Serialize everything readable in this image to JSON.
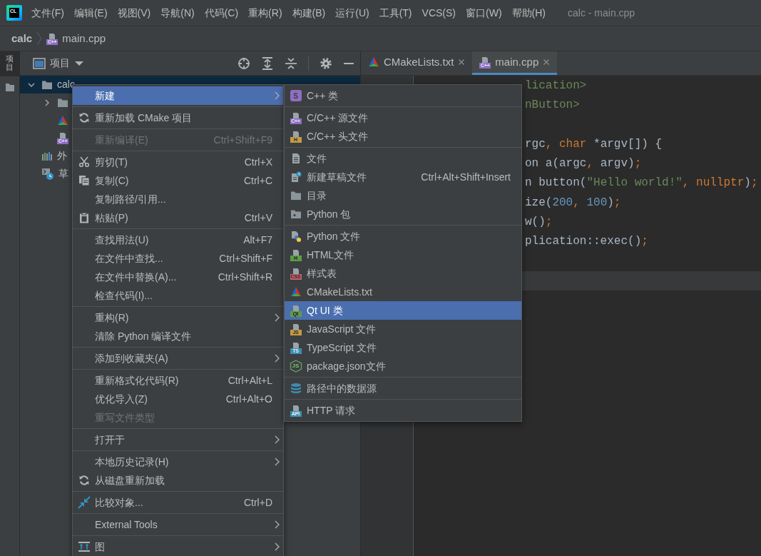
{
  "app_logo": {
    "text": "CL"
  },
  "menu_bar": {
    "items": [
      "文件(F)",
      "编辑(E)",
      "视图(V)",
      "导航(N)",
      "代码(C)",
      "重构(R)",
      "构建(B)",
      "运行(U)",
      "工具(T)",
      "VCS(S)",
      "窗口(W)",
      "帮助(H)"
    ],
    "title": "calc - main.cpp"
  },
  "breadcrumb": [
    {
      "label": "calc",
      "kind": "project"
    },
    {
      "label": "main.cpp",
      "kind": "cpp-source",
      "badge": "C++"
    }
  ],
  "side_strip": {
    "label": "项目",
    "selected": true
  },
  "project_panel": {
    "title": "项目"
  },
  "tree": [
    {
      "label": "calc",
      "kind": "folder",
      "expanded": true,
      "selected": true,
      "children": [
        {
          "kind": "folder",
          "expanded": false,
          "selected": false
        },
        {
          "kind": "cmake",
          "selected": false
        },
        {
          "kind": "cpp-source",
          "badge": "C++",
          "selected": false
        }
      ]
    },
    {
      "label": "外",
      "kind": "libraries",
      "selected": false
    },
    {
      "label": "草",
      "kind": "scratches",
      "selected": false
    }
  ],
  "editor_tabs": [
    {
      "label": "CMakeLists.txt",
      "kind": "cmake",
      "selected": false
    },
    {
      "label": "main.cpp",
      "kind": "cpp-source",
      "badge": "C++",
      "selected": true
    }
  ],
  "code_lines": [
    {
      "current": false,
      "tokens": [
        {
          "text": "lication>",
          "kind": "string"
        }
      ]
    },
    {
      "current": false,
      "tokens": [
        {
          "text": "nButton>",
          "kind": "string"
        }
      ]
    },
    {
      "current": false
    },
    {
      "current": false,
      "tokens": [
        {
          "text": "rgc",
          "kind": "plain"
        },
        {
          "text": ", ",
          "kind": "punct"
        },
        {
          "text": "char",
          "kind": "keyword"
        },
        {
          "text": " *argv[]) {",
          "kind": "plain"
        }
      ]
    },
    {
      "current": false,
      "tokens": [
        {
          "text": "on a(argc",
          "kind": "plain"
        },
        {
          "text": ", ",
          "kind": "punct"
        },
        {
          "text": "argv)",
          "kind": "plain"
        },
        {
          "text": ";",
          "kind": "punct"
        }
      ]
    },
    {
      "current": false,
      "tokens": [
        {
          "text": "n button(",
          "kind": "plain"
        },
        {
          "text": "\"Hello world!\"",
          "kind": "string"
        },
        {
          "text": ", ",
          "kind": "punct"
        },
        {
          "text": "nullptr",
          "kind": "keyword"
        },
        {
          "text": ")",
          "kind": "plain"
        },
        {
          "text": ";",
          "kind": "punct"
        }
      ]
    },
    {
      "current": false,
      "tokens": [
        {
          "text": "ize(",
          "kind": "plain"
        },
        {
          "text": "200",
          "kind": "number"
        },
        {
          "text": ", ",
          "kind": "punct"
        },
        {
          "text": "100",
          "kind": "number"
        },
        {
          "text": ")",
          "kind": "plain"
        },
        {
          "text": ";",
          "kind": "punct"
        }
      ]
    },
    {
      "current": false,
      "tokens": [
        {
          "text": "w()",
          "kind": "plain"
        },
        {
          "text": ";",
          "kind": "punct"
        }
      ]
    },
    {
      "current": false,
      "tokens": [
        {
          "text": "plication::exec()",
          "kind": "plain"
        },
        {
          "text": ";",
          "kind": "punct"
        }
      ]
    },
    {
      "current": false
    },
    {
      "current": true
    }
  ],
  "context_menu": {
    "groups": [
      [
        {
          "label": "新建",
          "kind": "text",
          "submenu": true,
          "selected": true,
          "disabled": false
        }
      ],
      [
        {
          "label": "重新加载 CMake 项目",
          "kind": "reload",
          "submenu": false,
          "selected": false,
          "disabled": false
        }
      ],
      [
        {
          "label": "重新编译(E)",
          "kind": "text",
          "shortcut": "Ctrl+Shift+F9",
          "submenu": false,
          "selected": false,
          "disabled": true
        }
      ],
      [
        {
          "label": "剪切(T)",
          "kind": "cut",
          "shortcut": "Ctrl+X",
          "submenu": false,
          "selected": false,
          "disabled": false
        },
        {
          "label": "复制(C)",
          "kind": "copy",
          "shortcut": "Ctrl+C",
          "submenu": false,
          "selected": false,
          "disabled": false
        },
        {
          "label": "复制路径/引用...",
          "kind": "text",
          "submenu": false,
          "selected": false,
          "disabled": false
        },
        {
          "label": "粘贴(P)",
          "kind": "paste",
          "shortcut": "Ctrl+V",
          "submenu": false,
          "selected": false,
          "disabled": false
        }
      ],
      [
        {
          "label": "查找用法(U)",
          "kind": "text",
          "shortcut": "Alt+F7",
          "submenu": false,
          "selected": false,
          "disabled": false
        },
        {
          "label": "在文件中查找...",
          "kind": "text",
          "shortcut": "Ctrl+Shift+F",
          "submenu": false,
          "selected": false,
          "disabled": false
        },
        {
          "label": "在文件中替换(A)...",
          "kind": "text",
          "shortcut": "Ctrl+Shift+R",
          "submenu": false,
          "selected": false,
          "disabled": false
        },
        {
          "label": "检查代码(I)...",
          "kind": "text",
          "submenu": false,
          "selected": false,
          "disabled": false
        }
      ],
      [
        {
          "label": "重构(R)",
          "kind": "text",
          "submenu": true,
          "selected": false,
          "disabled": false
        },
        {
          "label": "清除 Python 编译文件",
          "kind": "text",
          "submenu": false,
          "selected": false,
          "disabled": false
        }
      ],
      [
        {
          "label": "添加到收藏夹(A)",
          "kind": "text",
          "submenu": true,
          "selected": false,
          "disabled": false
        }
      ],
      [
        {
          "label": "重新格式化代码(R)",
          "kind": "text",
          "shortcut": "Ctrl+Alt+L",
          "submenu": false,
          "selected": false,
          "disabled": false
        },
        {
          "label": "优化导入(Z)",
          "kind": "text",
          "shortcut": "Ctrl+Alt+O",
          "submenu": false,
          "selected": false,
          "disabled": false
        },
        {
          "label": "重写文件类型",
          "kind": "text",
          "submenu": false,
          "selected": false,
          "disabled": true
        }
      ],
      [
        {
          "label": "打开于",
          "kind": "text",
          "submenu": true,
          "selected": false,
          "disabled": false
        }
      ],
      [
        {
          "label": "本地历史记录(H)",
          "kind": "text",
          "submenu": true,
          "selected": false,
          "disabled": false
        },
        {
          "label": "从磁盘重新加载",
          "kind": "reload",
          "submenu": false,
          "selected": false,
          "disabled": false
        }
      ],
      [
        {
          "label": "比较对象...",
          "kind": "compare",
          "shortcut": "Ctrl+D",
          "submenu": false,
          "selected": false,
          "disabled": false
        }
      ],
      [
        {
          "label": "External Tools",
          "kind": "text",
          "submenu": true,
          "selected": false,
          "disabled": false
        }
      ],
      [
        {
          "label": "图",
          "kind": "diagram",
          "submenu": true,
          "selected": false,
          "disabled": false
        }
      ]
    ]
  },
  "new_submenu": {
    "groups": [
      [
        {
          "label": "C++ 类",
          "kind": "cpp-class",
          "badge": "S",
          "selected": false,
          "disabled": false
        }
      ],
      [
        {
          "label": "C/C++ 源文件",
          "kind": "cpp-source",
          "badge": "C++",
          "selected": false,
          "disabled": false
        },
        {
          "label": "C/C++ 头文件",
          "kind": "header",
          "badge": "H",
          "selected": false,
          "disabled": false
        }
      ],
      [
        {
          "label": "文件",
          "kind": "file",
          "selected": false,
          "disabled": false
        },
        {
          "label": "新建草稿文件",
          "kind": "scratch",
          "shortcut": "Ctrl+Alt+Shift+Insert",
          "selected": false,
          "disabled": false
        },
        {
          "label": "目录",
          "kind": "directory",
          "selected": false,
          "disabled": false
        },
        {
          "label": "Python 包",
          "kind": "python-package",
          "selected": false,
          "disabled": false
        }
      ],
      [
        {
          "label": "Python 文件",
          "kind": "python-file",
          "selected": false,
          "disabled": false
        },
        {
          "label": "HTML文件",
          "kind": "html",
          "badge": "H",
          "selected": false,
          "disabled": false
        },
        {
          "label": "样式表",
          "kind": "css",
          "badge": "CSS",
          "selected": false,
          "disabled": false
        },
        {
          "label": "CMakeLists.txt",
          "kind": "cmake",
          "selected": false,
          "disabled": false
        },
        {
          "label": "Qt UI 类",
          "kind": "qt-ui",
          "badge": "Qt",
          "selected": true,
          "disabled": false
        },
        {
          "label": "JavaScript 文件",
          "kind": "js",
          "badge": "JS",
          "selected": false,
          "disabled": false
        },
        {
          "label": "TypeScript 文件",
          "kind": "ts",
          "badge": "TS",
          "selected": false,
          "disabled": false
        },
        {
          "label": "package.json文件",
          "kind": "package-json",
          "badge": "JS",
          "selected": false,
          "disabled": false
        }
      ],
      [
        {
          "label": "路径中的数据源",
          "kind": "datasource",
          "selected": false,
          "disabled": false
        }
      ],
      [
        {
          "label": "HTTP 请求",
          "kind": "http",
          "badge": "API",
          "selected": false,
          "disabled": false
        }
      ]
    ]
  }
}
